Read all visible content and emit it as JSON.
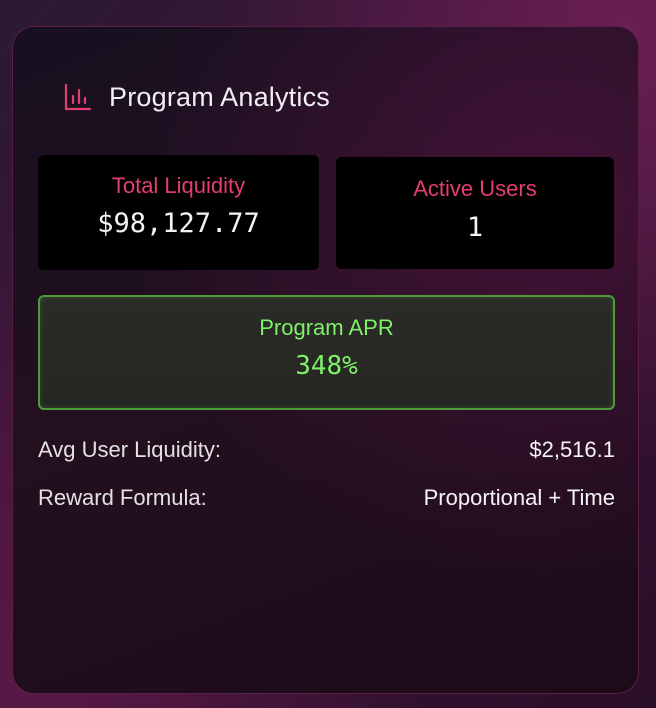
{
  "panel": {
    "title": "Program Analytics",
    "icon": "bar-chart-icon",
    "accent_color": "#e23e6e"
  },
  "stats": {
    "total_liquidity": {
      "label": "Total Liquidity",
      "value": "$98,127.77"
    },
    "active_users": {
      "label": "Active Users",
      "value": "1"
    }
  },
  "apr": {
    "label": "Program APR",
    "value": "348%",
    "color": "#7ff06a"
  },
  "details": {
    "avg_user_liquidity": {
      "label": "Avg User Liquidity:",
      "value": "$2,516.1"
    },
    "reward_formula": {
      "label": "Reward Formula:",
      "value": "Proportional + Time"
    }
  }
}
